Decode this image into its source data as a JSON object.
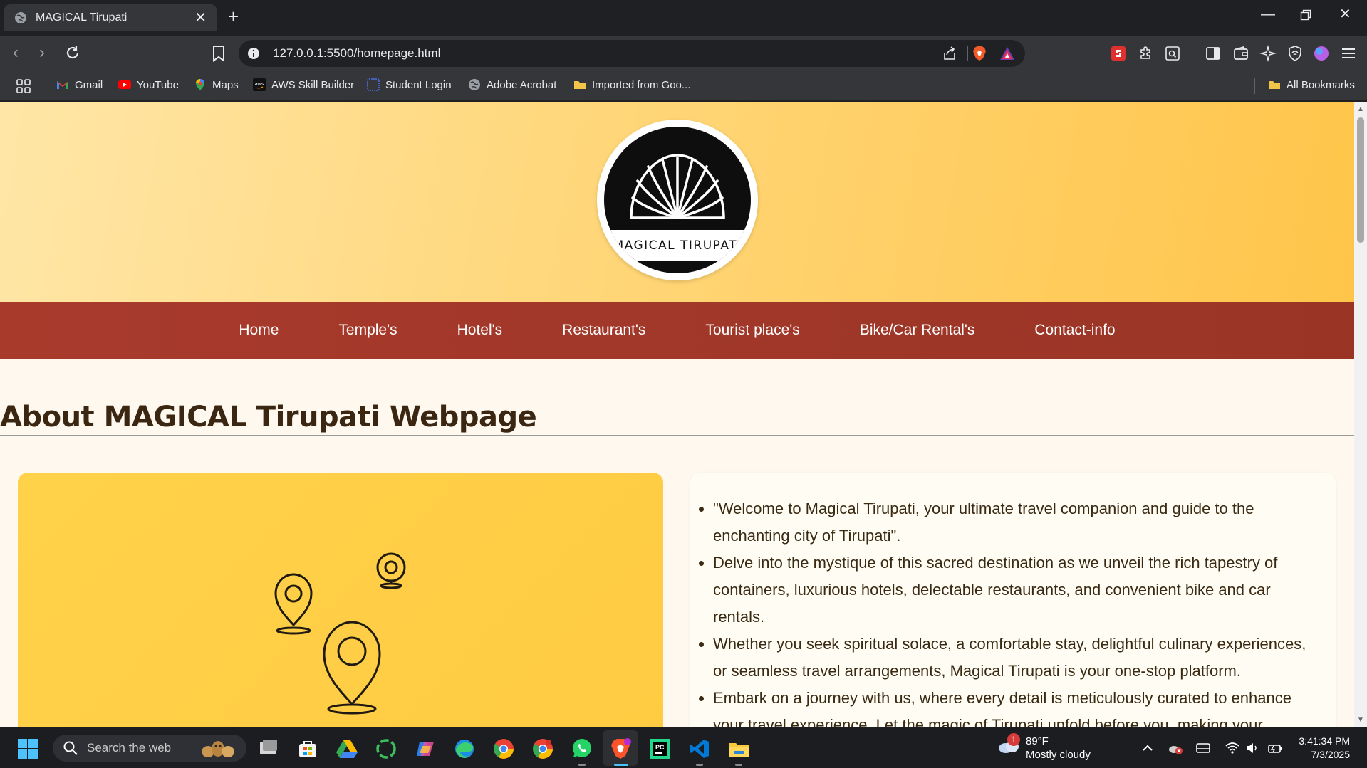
{
  "browser": {
    "tab_title": "MAGICAL Tirupati",
    "url": "127.0.0.1:5500/homepage.html"
  },
  "bookmarks": {
    "items": [
      {
        "label": "Gmail",
        "icon": "gmail-icon"
      },
      {
        "label": "YouTube",
        "icon": "youtube-icon"
      },
      {
        "label": "Maps",
        "icon": "maps-icon"
      },
      {
        "label": "AWS Skill Builder",
        "icon": "aws-icon"
      },
      {
        "label": "Student Login",
        "icon": "globe-icon"
      },
      {
        "label": "Adobe Acrobat",
        "icon": "globe-icon"
      },
      {
        "label": "Imported from Goo...",
        "icon": "folder-icon"
      }
    ],
    "all_label": "All Bookmarks"
  },
  "page": {
    "logo_text": "MAGICAL TIRUPATI",
    "nav": [
      "Home",
      "Temple's",
      "Hotel's",
      "Restaurant's",
      "Tourist place's",
      "Bike/Car Rental's",
      "Contact-info"
    ],
    "about_title": "About MAGICAL Tirupati Webpage",
    "about_points": [
      "\"Welcome to Magical Tirupati, your ultimate travel companion and guide to the enchanting city of Tirupati\".",
      "Delve into the mystique of this sacred destination as we unveil the rich tapestry of containers, luxurious hotels, delectable restaurants, and convenient bike and car rentals.",
      "Whether you seek spiritual solace, a comfortable stay, delightful culinary experiences, or seamless travel arrangements, Magical Tirupati is your one-stop platform.",
      "Embark on a journey with us, where every detail is meticulously curated to enhance your travel experience. Let the magic of Tirupati unfold before you, making your"
    ],
    "colors": {
      "hero": "#ffd678",
      "nav": "#a83a2c",
      "card_left": "#ffcf45",
      "title": "#3b2612"
    }
  },
  "taskbar": {
    "search_placeholder": "Search the web",
    "weather_temp": "89°F",
    "weather_desc": "Mostly cloudy",
    "weather_badge": "1",
    "time": "3:41:34 PM",
    "date": "7/3/2025"
  }
}
